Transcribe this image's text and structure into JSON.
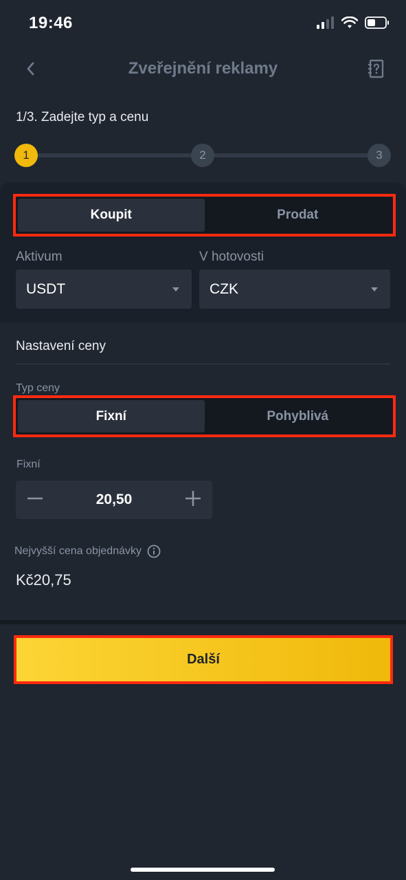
{
  "status_bar": {
    "time": "19:46"
  },
  "nav": {
    "title": "Zveřejnění reklamy"
  },
  "step": {
    "title": "1/3. Zadejte typ a cenu",
    "steps": [
      "1",
      "2",
      "3"
    ]
  },
  "trade_type": {
    "buy": "Koupit",
    "sell": "Prodat"
  },
  "asset": {
    "label": "Aktivum",
    "value": "USDT"
  },
  "fiat": {
    "label": "V hotovosti",
    "value": "CZK"
  },
  "price_settings": {
    "title": "Nastavení ceny",
    "type_label": "Typ ceny",
    "fixed": "Fixní",
    "floating": "Pohyblivá",
    "fixed_label": "Fixní",
    "fixed_value": "20,50",
    "max_price_label": "Nejvyšší cena objednávky",
    "max_price_value": "Kč20,75"
  },
  "next_button": {
    "label": "Další"
  },
  "colors": {
    "accent": "#f0b90b",
    "background": "#1f2630",
    "highlight": "#ff2a10"
  }
}
